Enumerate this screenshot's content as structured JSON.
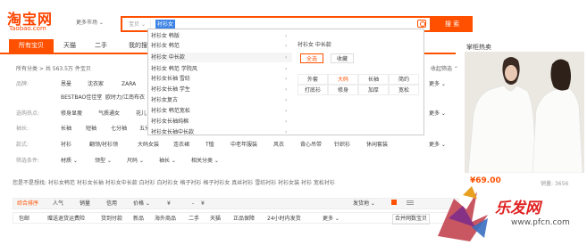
{
  "logo": {
    "title": "淘宝网",
    "subtitle": "Taobao.com"
  },
  "market": "更多市场 ⌄",
  "search": {
    "type": "宝贝 ⌄",
    "query": "衬衫女",
    "button": "搜 索"
  },
  "tabs": [
    "所有宝贝",
    "天猫",
    "二手",
    "我的搜索"
  ],
  "crumb": "所有分类 > 共 563.5万 件宝贝",
  "filters": [
    {
      "label": "品牌:",
      "values": [
        "恩曼",
        "沈衣家",
        "ZARA"
      ]
    },
    {
      "label": "",
      "values": [
        "BESTBAO佳佳堂",
        "欧时力/江南布衣"
      ]
    },
    {
      "label": "选购热点:",
      "values": [
        "修身显瘦",
        "气质通女",
        "花儿"
      ]
    },
    {
      "label": "袖长:",
      "values": [
        "长袖",
        "短袖",
        "七分袖",
        "五分袖"
      ]
    },
    {
      "label": "款式:",
      "values": [
        "衬衫",
        "翻领/衬衫领",
        "大码女装",
        "连衣裙",
        "T恤",
        "中老年服装",
        "风衣",
        "背心吊带",
        "针织衫",
        "休闲套装"
      ]
    },
    {
      "label": "筛选条件:",
      "values": [
        "材质 ⌄",
        "领型 ⌄",
        "尺码 ⌄",
        "袖长 ⌄",
        "相关分类 ⌄"
      ]
    }
  ],
  "dropdown": {
    "items": [
      "衬衫女 韩版",
      "衬衫女 韩范",
      "衬衫女 中长款",
      "衬衫女 韩范 学院风",
      "衬衫女长袖 雪纺",
      "衬衫女长袖 学生",
      "衬衫女复古",
      "衬衫女 韩范宽松",
      "衬衫女长袖纯棉",
      "衬衫女长袖中长款"
    ],
    "title": "衬衫女 中长款",
    "buttons": [
      "全选",
      "收藏"
    ],
    "grid": [
      "外套",
      "大码",
      "长袖",
      "简约",
      "打底衫",
      "修身",
      "加厚",
      "宽松"
    ]
  },
  "right": {
    "title": "掌柜热卖",
    "price": "¥69.00",
    "sales": "销量: 3656"
  },
  "related": "您是不是想找: 衬衫女韩范 衬衫女长袖 衬衫女中长款 白衬衫 白衬衫女 格子衬衫 格子衬衫女 真丝衬衫 雪纺衬衫 衬衫女装 衬衫 宽松衬衫",
  "sort": [
    "综合排序",
    "人气",
    "销量",
    "信用",
    "价格 ⌄",
    "¥",
    "-",
    "¥",
    "发货地 ⌄"
  ],
  "checks": [
    "包邮",
    "赠送退货运费险",
    "货到付款",
    "新品",
    "海外商品",
    "二手",
    "天猫",
    "正品保障",
    "24小时内发货",
    "更多 ⌄",
    "合并网数宝贝"
  ],
  "more": [
    "更多 ⌄",
    "多选 +"
  ],
  "watermark": "乐发网",
  "watermark_url": "www.pfcn.com",
  "colors": {
    "accent": "#ff5000"
  }
}
